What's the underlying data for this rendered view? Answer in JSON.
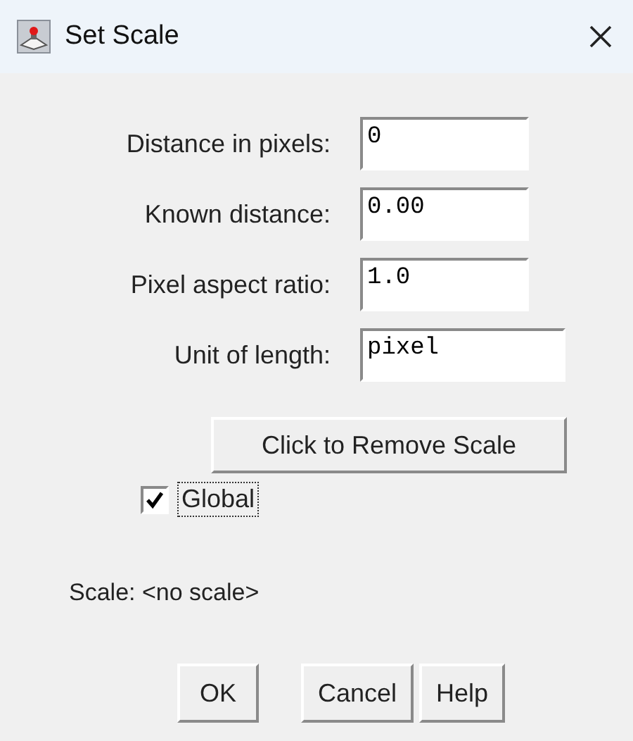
{
  "window": {
    "title": "Set Scale"
  },
  "fields": [
    {
      "label": "Distance in pixels:",
      "value": "0",
      "kind": "short"
    },
    {
      "label": "Known distance:",
      "value": "0.00",
      "kind": "short"
    },
    {
      "label": "Pixel aspect ratio:",
      "value": "1.0",
      "kind": "short"
    },
    {
      "label": "Unit of length:",
      "value": "pixel",
      "kind": "long"
    }
  ],
  "remove_button": "Click to Remove Scale",
  "global_checkbox": {
    "label": "Global",
    "checked": true
  },
  "scale_text": "Scale: <no scale>",
  "buttons": [
    "OK",
    "Cancel",
    "Help"
  ]
}
